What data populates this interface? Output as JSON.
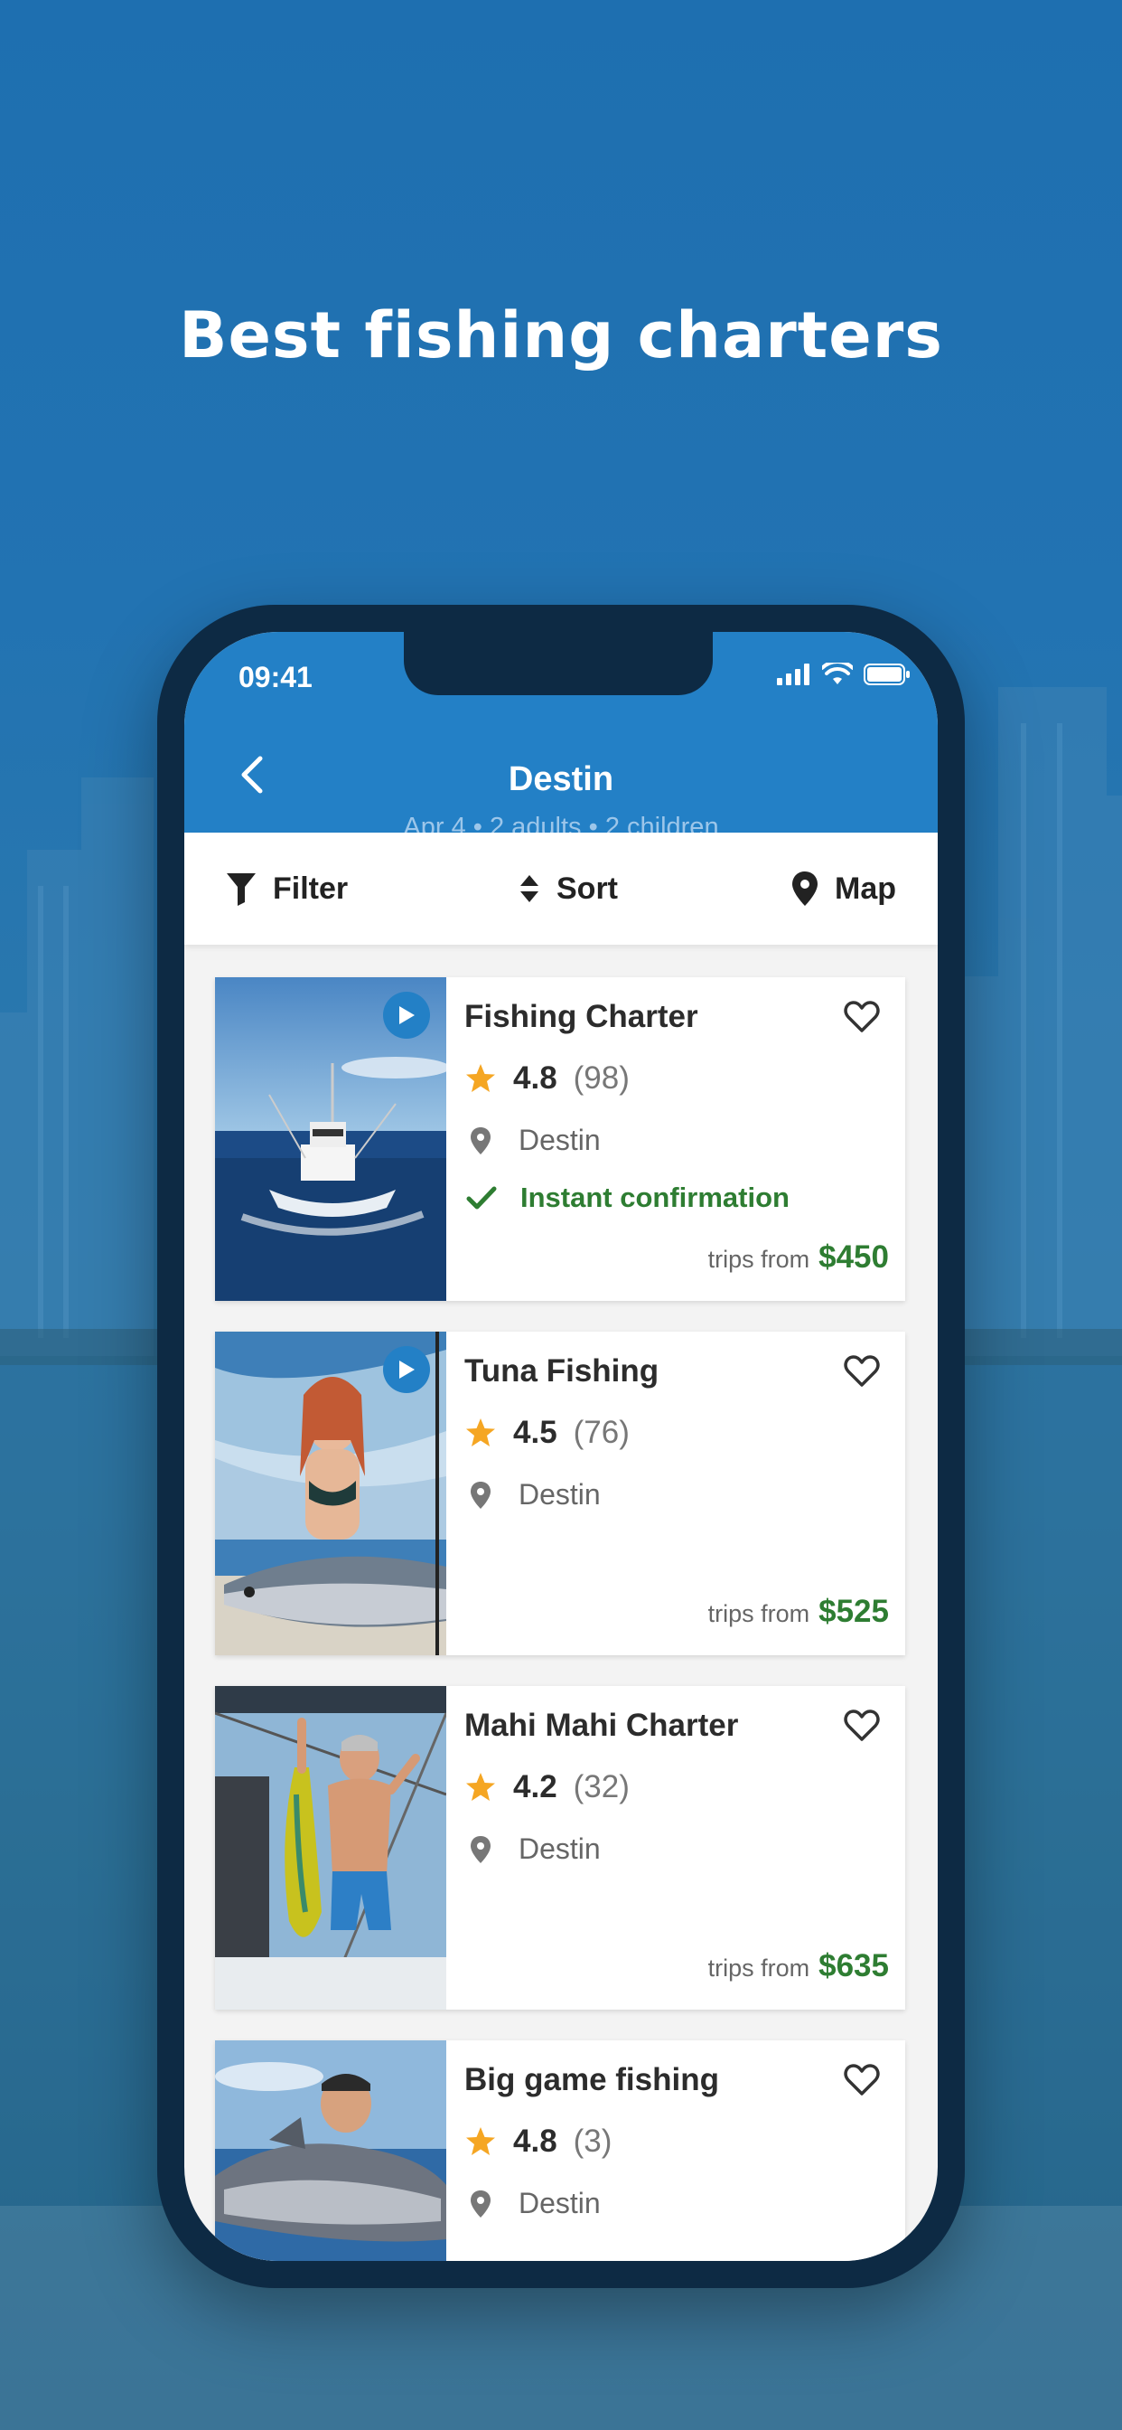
{
  "headline": "Best fishing charters",
  "status_bar": {
    "time": "09:41",
    "icons": [
      "cellular-signal-icon",
      "wifi-icon",
      "battery-icon"
    ]
  },
  "header": {
    "title": "Destin",
    "subtitle": "Apr 4 • 2 adults • 2 children",
    "back_icon": "chevron-left-icon"
  },
  "toolbar": {
    "filter_label": "Filter",
    "sort_label": "Sort",
    "map_label": "Map"
  },
  "listings": [
    {
      "title": "Fishing Charter",
      "rating": "4.8",
      "reviews": "(98)",
      "location": "Destin",
      "confirmation": "Instant confirmation",
      "price_prefix": "trips from",
      "price": "$450",
      "has_video": true
    },
    {
      "title": "Tuna Fishing",
      "rating": "4.5",
      "reviews": "(76)",
      "location": "Destin",
      "price_prefix": "trips from",
      "price": "$525",
      "has_video": true
    },
    {
      "title": "Mahi Mahi Charter",
      "rating": "4.2",
      "reviews": "(32)",
      "location": "Destin",
      "price_prefix": "trips from",
      "price": "$635",
      "has_video": false
    },
    {
      "title": "Big game fishing",
      "rating": "4.8",
      "reviews": "(3)",
      "location": "Destin",
      "has_video": false
    }
  ],
  "colors": {
    "header_blue": "#2380c6",
    "price_green": "#2e7d32",
    "star_orange": "#f5a623",
    "phone_frame": "#0d2a44"
  }
}
